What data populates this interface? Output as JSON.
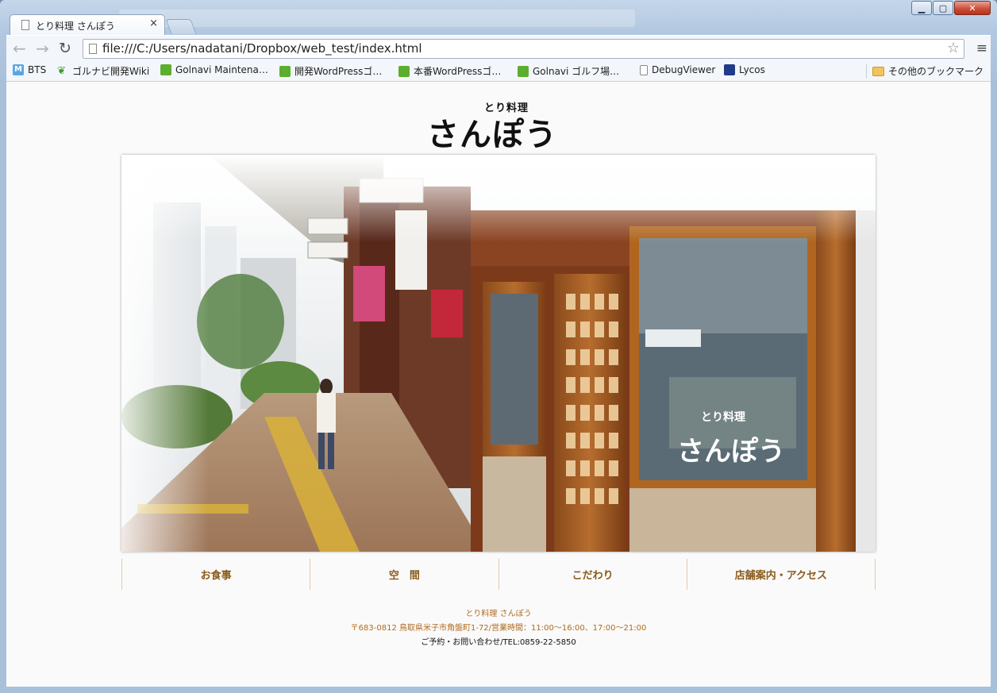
{
  "browser": {
    "tab_title": "とり料理 さんぽう",
    "tab_close": "×",
    "url": "file:///C:/Users/nadatani/Dropbox/web_test/index.html",
    "back_icon": "←",
    "forward_icon": "→",
    "reload_icon": "↻",
    "star_icon": "☆",
    "menu_icon": "≡",
    "caption": {
      "minimize": "▁",
      "maximize": "▢",
      "close": "✕"
    }
  },
  "bookmarks": [
    {
      "label": "BTS",
      "icon": "m"
    },
    {
      "label": "ゴルナビ開発Wiki",
      "icon": "leaf"
    },
    {
      "label": "Golnavi Maintena…",
      "icon": "g"
    },
    {
      "label": "開発WordPressゴ…",
      "icon": "g"
    },
    {
      "label": "本番WordPressゴ…",
      "icon": "g"
    },
    {
      "label": "Golnavi ゴルフ場…",
      "icon": "g"
    },
    {
      "label": "DebugViewer",
      "icon": "doc"
    },
    {
      "label": "Lycos",
      "icon": "ly"
    },
    {
      "label": "その他のブックマーク",
      "icon": "folder"
    }
  ],
  "page": {
    "logo_ruby": "とり料理",
    "logo_main": "さんぽう",
    "hero_sign": "とり料理",
    "hero_sign_main": "さんぽう",
    "nav": [
      "お食事",
      "空　間",
      "こだわり",
      "店舗案内・アクセス"
    ],
    "footer": {
      "name": "とり料理 さんぽう",
      "address": "〒683-0812 鳥取県米子市角盤町1-72/営業時間：11:00～16:00、17:00～21:00",
      "contact": "ご予約・お問い合わせ/TEL:0859-22-5850"
    }
  }
}
